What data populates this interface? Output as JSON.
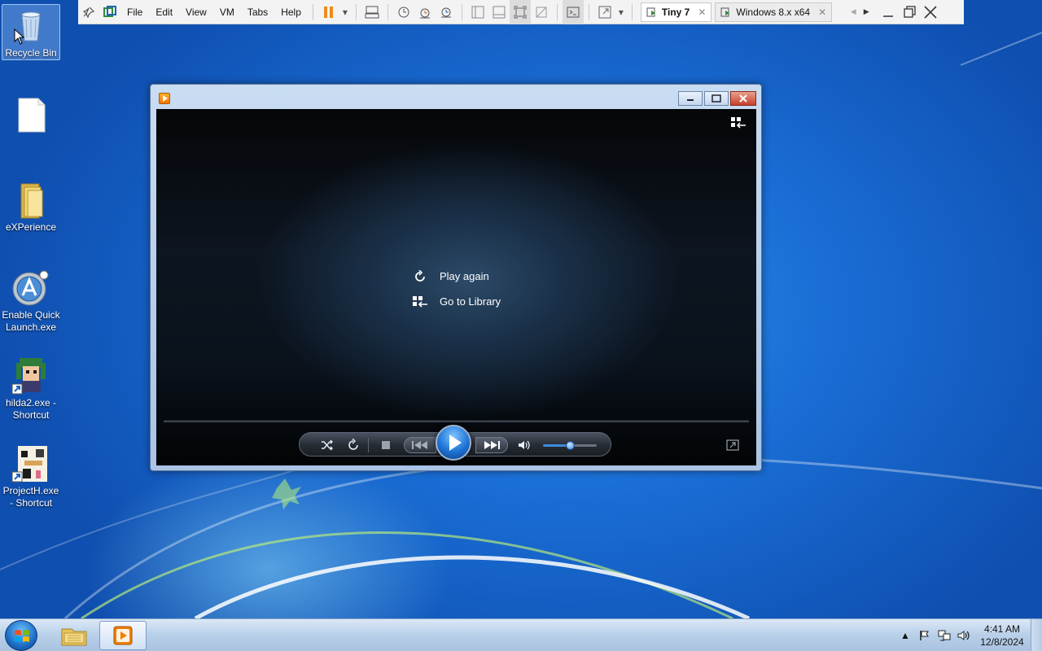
{
  "vmware": {
    "menus": [
      "File",
      "Edit",
      "View",
      "VM",
      "Tabs",
      "Help"
    ],
    "tabs": [
      {
        "label": "Tiny 7",
        "active": true
      },
      {
        "label": "Windows 8.x x64",
        "active": false
      }
    ]
  },
  "desktop": {
    "icons": [
      {
        "label": "Recycle Bin",
        "icon": "recycle-bin-icon"
      },
      {
        "label": "",
        "icon": "blank-document-icon"
      },
      {
        "label": "eXPerience",
        "icon": "folder-icon"
      },
      {
        "label": "Enable Quick Launch.exe",
        "icon": "quick-launch-app-icon"
      },
      {
        "label": "hilda2.exe - Shortcut",
        "icon": "hilda-shortcut-icon"
      },
      {
        "label": "ProjectH.exe - Shortcut",
        "icon": "projecth-shortcut-icon"
      }
    ]
  },
  "player": {
    "center_actions": [
      "Play again",
      "Go to Library"
    ],
    "volume_level": 0.5,
    "colors": {
      "play_button": "#1f73d6",
      "volume_fill": "#3b8ae0"
    }
  },
  "taskbar": {
    "clock_time": "4:41 AM",
    "clock_date": "12/8/2024"
  }
}
